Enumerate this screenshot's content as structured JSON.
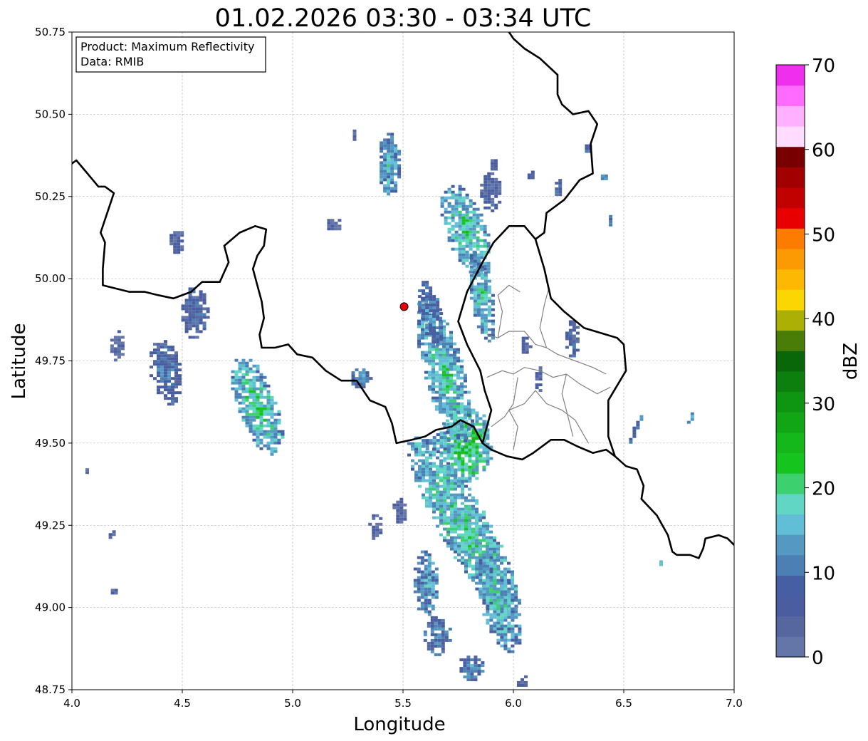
{
  "chart_data": {
    "type": "heatmap",
    "title": "01.02.2026 03:30 - 03:34 UTC",
    "xlabel": "Longitude",
    "ylabel": "Latitude",
    "xlim": [
      4.0,
      7.0
    ],
    "ylim": [
      48.75,
      50.75
    ],
    "x_ticks": [
      "4.0",
      "4.5",
      "5.0",
      "5.5",
      "6.0",
      "6.5",
      "7.0"
    ],
    "y_ticks": [
      "48.75",
      "49.00",
      "49.25",
      "49.50",
      "49.75",
      "50.00",
      "50.25",
      "50.50",
      "50.75"
    ],
    "grid": true,
    "annotation": {
      "lines": [
        "Product: Maximum Reflectivity",
        "Data: RMIB"
      ],
      "placement": "top-left"
    },
    "radar_site": {
      "lon": 5.505,
      "lat": 49.915,
      "color": "#e8000b"
    },
    "colorbar": {
      "label": "dBZ",
      "min": 0,
      "max": 70,
      "ticks": [
        "0",
        "10",
        "20",
        "30",
        "40",
        "50",
        "60",
        "70"
      ],
      "colors": [
        "#6475a8",
        "#56679f",
        "#4a5da0",
        "#465ea2",
        "#4c80b5",
        "#5599c3",
        "#62bdd7",
        "#62d6c5",
        "#3dd06e",
        "#16c41e",
        "#14b81a",
        "#10a615",
        "#0e9512",
        "#0c7f0f",
        "#096609",
        "#4a7d08",
        "#adb004",
        "#fcd602",
        "#fcb802",
        "#fc9a03",
        "#fc7c00",
        "#e80000",
        "#c10000",
        "#a20000",
        "#790000",
        "#ffdcff",
        "#ffb1ff",
        "#ff6bff",
        "#ee2fee"
      ]
    },
    "echo_cells": [
      {
        "lon": 5.77,
        "lat": 49.25,
        "rx": 0.11,
        "ry": 0.32,
        "rot": -30,
        "dbz": 18,
        "core": 24
      },
      {
        "lon": 5.92,
        "lat": 49.02,
        "rx": 0.08,
        "ry": 0.16,
        "rot": -18,
        "dbz": 16,
        "core": 23
      },
      {
        "lon": 5.78,
        "lat": 49.5,
        "rx": 0.12,
        "ry": 0.12,
        "rot": 0,
        "dbz": 20,
        "core": 30
      },
      {
        "lon": 5.68,
        "lat": 49.72,
        "rx": 0.09,
        "ry": 0.24,
        "rot": -15,
        "dbz": 17,
        "core": 24
      },
      {
        "lon": 5.78,
        "lat": 50.15,
        "rx": 0.09,
        "ry": 0.15,
        "rot": -20,
        "dbz": 17,
        "core": 26
      },
      {
        "lon": 5.85,
        "lat": 49.95,
        "rx": 0.05,
        "ry": 0.14,
        "rot": -10,
        "dbz": 16,
        "core": 24
      },
      {
        "lon": 5.62,
        "lat": 49.9,
        "rx": 0.05,
        "ry": 0.1,
        "rot": -10,
        "dbz": 12,
        "core": 18
      },
      {
        "lon": 5.43,
        "lat": 50.35,
        "rx": 0.05,
        "ry": 0.1,
        "rot": 0,
        "dbz": 14,
        "core": 22
      },
      {
        "lon": 5.27,
        "lat": 50.44,
        "rx": 0.01,
        "ry": 0.02,
        "rot": 0,
        "dbz": 8,
        "core": 8
      },
      {
        "lon": 4.83,
        "lat": 49.62,
        "rx": 0.09,
        "ry": 0.16,
        "rot": -20,
        "dbz": 17,
        "core": 26
      },
      {
        "lon": 4.55,
        "lat": 49.9,
        "rx": 0.06,
        "ry": 0.08,
        "rot": 0,
        "dbz": 10,
        "core": 12
      },
      {
        "lon": 4.42,
        "lat": 49.72,
        "rx": 0.07,
        "ry": 0.1,
        "rot": -10,
        "dbz": 10,
        "core": 16
      },
      {
        "lon": 4.47,
        "lat": 50.12,
        "rx": 0.03,
        "ry": 0.04,
        "rot": 0,
        "dbz": 8,
        "core": 8
      },
      {
        "lon": 4.2,
        "lat": 49.8,
        "rx": 0.03,
        "ry": 0.05,
        "rot": 0,
        "dbz": 8,
        "core": 8
      },
      {
        "lon": 5.3,
        "lat": 49.7,
        "rx": 0.05,
        "ry": 0.03,
        "rot": -25,
        "dbz": 12,
        "core": 18
      },
      {
        "lon": 5.65,
        "lat": 49.5,
        "rx": 0.08,
        "ry": 0.03,
        "rot": 0,
        "dbz": 14,
        "core": 22
      },
      {
        "lon": 5.6,
        "lat": 49.08,
        "rx": 0.06,
        "ry": 0.1,
        "rot": 0,
        "dbz": 14,
        "core": 20
      },
      {
        "lon": 5.65,
        "lat": 48.92,
        "rx": 0.06,
        "ry": 0.06,
        "rot": 0,
        "dbz": 12,
        "core": 16
      },
      {
        "lon": 5.8,
        "lat": 48.82,
        "rx": 0.06,
        "ry": 0.04,
        "rot": 0,
        "dbz": 12,
        "core": 20
      },
      {
        "lon": 6.03,
        "lat": 48.78,
        "rx": 0.03,
        "ry": 0.02,
        "rot": 0,
        "dbz": 8,
        "core": 8
      },
      {
        "lon": 5.89,
        "lat": 50.27,
        "rx": 0.05,
        "ry": 0.06,
        "rot": 0,
        "dbz": 10,
        "core": 12
      },
      {
        "lon": 5.91,
        "lat": 50.35,
        "rx": 0.02,
        "ry": 0.02,
        "rot": 0,
        "dbz": 8,
        "core": 16
      },
      {
        "lon": 6.26,
        "lat": 49.82,
        "rx": 0.03,
        "ry": 0.06,
        "rot": 0,
        "dbz": 10,
        "core": 12
      },
      {
        "lon": 6.11,
        "lat": 49.7,
        "rx": 0.02,
        "ry": 0.04,
        "rot": 0,
        "dbz": 8,
        "core": 10
      },
      {
        "lon": 6.05,
        "lat": 49.8,
        "rx": 0.02,
        "ry": 0.03,
        "rot": 0,
        "dbz": 8,
        "core": 10
      },
      {
        "lon": 6.55,
        "lat": 49.55,
        "rx": 0.01,
        "ry": 0.05,
        "rot": 25,
        "dbz": 12,
        "core": 16
      },
      {
        "lon": 6.8,
        "lat": 49.58,
        "rx": 0.01,
        "ry": 0.02,
        "rot": 20,
        "dbz": 14,
        "core": 18
      },
      {
        "lon": 6.66,
        "lat": 49.14,
        "rx": 0.015,
        "ry": 0.01,
        "rot": 0,
        "dbz": 16,
        "core": 18
      },
      {
        "lon": 6.43,
        "lat": 50.18,
        "rx": 0.01,
        "ry": 0.02,
        "rot": 0,
        "dbz": 12,
        "core": 16
      },
      {
        "lon": 6.4,
        "lat": 50.31,
        "rx": 0.02,
        "ry": 0.01,
        "rot": 0,
        "dbz": 14,
        "core": 18
      },
      {
        "lon": 6.2,
        "lat": 50.28,
        "rx": 0.02,
        "ry": 0.03,
        "rot": 0,
        "dbz": 10,
        "core": 12
      },
      {
        "lon": 6.07,
        "lat": 50.32,
        "rx": 0.015,
        "ry": 0.015,
        "rot": 0,
        "dbz": 10,
        "core": 12
      },
      {
        "lon": 6.33,
        "lat": 50.4,
        "rx": 0.02,
        "ry": 0.015,
        "rot": 0,
        "dbz": 10,
        "core": 12
      },
      {
        "lon": 4.18,
        "lat": 49.23,
        "rx": 0.02,
        "ry": 0.02,
        "rot": 0,
        "dbz": 8,
        "core": 8
      },
      {
        "lon": 4.18,
        "lat": 49.05,
        "rx": 0.02,
        "ry": 0.01,
        "rot": 0,
        "dbz": 8,
        "core": 8
      },
      {
        "lon": 4.06,
        "lat": 49.42,
        "rx": 0.01,
        "ry": 0.01,
        "rot": 0,
        "dbz": 8,
        "core": 8
      },
      {
        "lon": 5.18,
        "lat": 50.17,
        "rx": 0.04,
        "ry": 0.02,
        "rot": 0,
        "dbz": 8,
        "core": 8
      },
      {
        "lon": 5.37,
        "lat": 49.25,
        "rx": 0.03,
        "ry": 0.04,
        "rot": 0,
        "dbz": 8,
        "core": 8
      },
      {
        "lon": 5.48,
        "lat": 49.3,
        "rx": 0.03,
        "ry": 0.04,
        "rot": 0,
        "dbz": 8,
        "core": 8
      }
    ],
    "borders": [
      [
        [
          4.0,
          50.35
        ],
        [
          4.02,
          50.36
        ],
        [
          4.07,
          50.32
        ],
        [
          4.12,
          50.28
        ],
        [
          4.15,
          50.28
        ],
        [
          4.19,
          50.26
        ],
        [
          4.17,
          50.22
        ],
        [
          4.13,
          50.14
        ],
        [
          4.15,
          50.11
        ],
        [
          4.14,
          50.03
        ],
        [
          4.14,
          49.98
        ],
        [
          4.2,
          49.97
        ],
        [
          4.26,
          49.96
        ],
        [
          4.33,
          49.96
        ],
        [
          4.39,
          49.95
        ],
        [
          4.46,
          49.94
        ],
        [
          4.54,
          49.96
        ],
        [
          4.59,
          49.99
        ],
        [
          4.67,
          49.99
        ],
        [
          4.71,
          50.05
        ],
        [
          4.69,
          50.1
        ],
        [
          4.76,
          50.14
        ],
        [
          4.83,
          50.16
        ],
        [
          4.88,
          50.15
        ],
        [
          4.87,
          50.1
        ],
        [
          4.84,
          50.07
        ],
        [
          4.82,
          50.03
        ],
        [
          4.84,
          49.98
        ],
        [
          4.86,
          49.93
        ],
        [
          4.87,
          49.88
        ],
        [
          4.85,
          49.83
        ],
        [
          4.86,
          49.79
        ],
        [
          4.92,
          49.79
        ],
        [
          4.98,
          49.8
        ],
        [
          5.02,
          49.77
        ],
        [
          5.09,
          49.76
        ],
        [
          5.15,
          49.72
        ],
        [
          5.22,
          49.69
        ],
        [
          5.29,
          49.69
        ],
        [
          5.33,
          49.65
        ],
        [
          5.35,
          49.63
        ],
        [
          5.42,
          49.61
        ],
        [
          5.45,
          49.56
        ],
        [
          5.47,
          49.5
        ],
        [
          5.54,
          49.51
        ],
        [
          5.6,
          49.52
        ],
        [
          5.65,
          49.54
        ],
        [
          5.72,
          49.55
        ],
        [
          5.76,
          49.57
        ],
        [
          5.82,
          49.55
        ],
        [
          5.86,
          49.5
        ],
        [
          5.9,
          49.48
        ],
        [
          5.97,
          49.46
        ],
        [
          6.04,
          49.45
        ],
        [
          6.09,
          49.47
        ],
        [
          6.17,
          49.51
        ],
        [
          6.23,
          49.51
        ],
        [
          6.29,
          49.49
        ],
        [
          6.36,
          49.47
        ],
        [
          6.42,
          49.48
        ],
        [
          6.46,
          49.46
        ],
        [
          6.51,
          49.43
        ],
        [
          6.56,
          49.42
        ],
        [
          6.59,
          49.37
        ],
        [
          6.58,
          49.33
        ],
        [
          6.65,
          49.28
        ],
        [
          6.7,
          49.22
        ],
        [
          6.72,
          49.17
        ],
        [
          6.74,
          49.16
        ],
        [
          6.8,
          49.16
        ],
        [
          6.84,
          49.15
        ],
        [
          6.86,
          49.18
        ],
        [
          6.87,
          49.21
        ],
        [
          6.93,
          49.22
        ],
        [
          6.97,
          49.21
        ],
        [
          7.0,
          49.19
        ]
      ],
      [
        [
          6.46,
          49.46
        ],
        [
          6.43,
          49.52
        ],
        [
          6.43,
          49.63
        ],
        [
          6.51,
          49.72
        ],
        [
          6.5,
          49.8
        ],
        [
          6.47,
          49.82
        ],
        [
          6.32,
          49.85
        ],
        [
          6.23,
          49.9
        ],
        [
          6.17,
          49.94
        ],
        [
          6.14,
          50.03
        ],
        [
          6.1,
          50.12
        ],
        [
          6.05,
          50.16
        ],
        [
          5.98,
          50.16
        ],
        [
          5.91,
          50.11
        ],
        [
          5.86,
          50.05
        ],
        [
          5.79,
          49.96
        ],
        [
          5.75,
          49.87
        ],
        [
          5.79,
          49.8
        ],
        [
          5.85,
          49.72
        ],
        [
          5.87,
          49.66
        ],
        [
          5.9,
          49.6
        ],
        [
          5.86,
          49.5
        ]
      ],
      [
        [
          6.1,
          50.12
        ],
        [
          6.14,
          50.14
        ],
        [
          6.15,
          50.2
        ],
        [
          6.23,
          50.24
        ],
        [
          6.3,
          50.3
        ],
        [
          6.36,
          50.32
        ],
        [
          6.35,
          50.41
        ],
        [
          6.38,
          50.47
        ],
        [
          6.34,
          50.51
        ],
        [
          6.27,
          50.5
        ],
        [
          6.22,
          50.53
        ],
        [
          6.2,
          50.56
        ],
        [
          6.2,
          50.62
        ],
        [
          6.12,
          50.67
        ],
        [
          6.05,
          50.7
        ],
        [
          6.0,
          50.73
        ],
        [
          5.98,
          50.75
        ]
      ],
      [
        [
          5.3,
          50.75
        ],
        [
          5.32,
          50.77
        ]
      ]
    ],
    "internal_borders": [
      [
        [
          5.88,
          49.83
        ],
        [
          5.93,
          49.82
        ],
        [
          5.98,
          49.84
        ],
        [
          6.05,
          49.84
        ],
        [
          6.1,
          49.8
        ],
        [
          6.15,
          49.79
        ],
        [
          6.2,
          49.77
        ],
        [
          6.28,
          49.75
        ],
        [
          6.36,
          49.73
        ],
        [
          6.42,
          49.71
        ]
      ],
      [
        [
          5.88,
          49.7
        ],
        [
          5.95,
          49.72
        ],
        [
          6.0,
          49.71
        ],
        [
          6.05,
          49.73
        ],
        [
          6.12,
          49.72
        ],
        [
          6.18,
          49.7
        ],
        [
          6.24,
          49.71
        ],
        [
          6.3,
          49.68
        ],
        [
          6.38,
          49.65
        ],
        [
          6.44,
          49.67
        ]
      ],
      [
        [
          6.0,
          49.48
        ],
        [
          6.02,
          49.55
        ],
        [
          5.98,
          49.6
        ],
        [
          6.05,
          49.62
        ],
        [
          6.1,
          49.66
        ],
        [
          6.15,
          49.62
        ],
        [
          6.22,
          49.6
        ],
        [
          6.28,
          49.57
        ],
        [
          6.34,
          49.5
        ]
      ],
      [
        [
          5.9,
          49.55
        ],
        [
          5.96,
          49.58
        ],
        [
          6.0,
          49.62
        ],
        [
          6.02,
          49.7
        ]
      ],
      [
        [
          6.15,
          49.79
        ],
        [
          6.12,
          49.85
        ],
        [
          6.14,
          49.92
        ],
        [
          6.16,
          49.97
        ]
      ],
      [
        [
          6.24,
          49.71
        ],
        [
          6.22,
          49.65
        ],
        [
          6.24,
          49.6
        ],
        [
          6.27,
          49.52
        ]
      ],
      [
        [
          5.93,
          49.82
        ],
        [
          5.95,
          49.9
        ],
        [
          5.93,
          49.95
        ],
        [
          5.98,
          49.98
        ],
        [
          6.03,
          49.96
        ]
      ]
    ]
  }
}
